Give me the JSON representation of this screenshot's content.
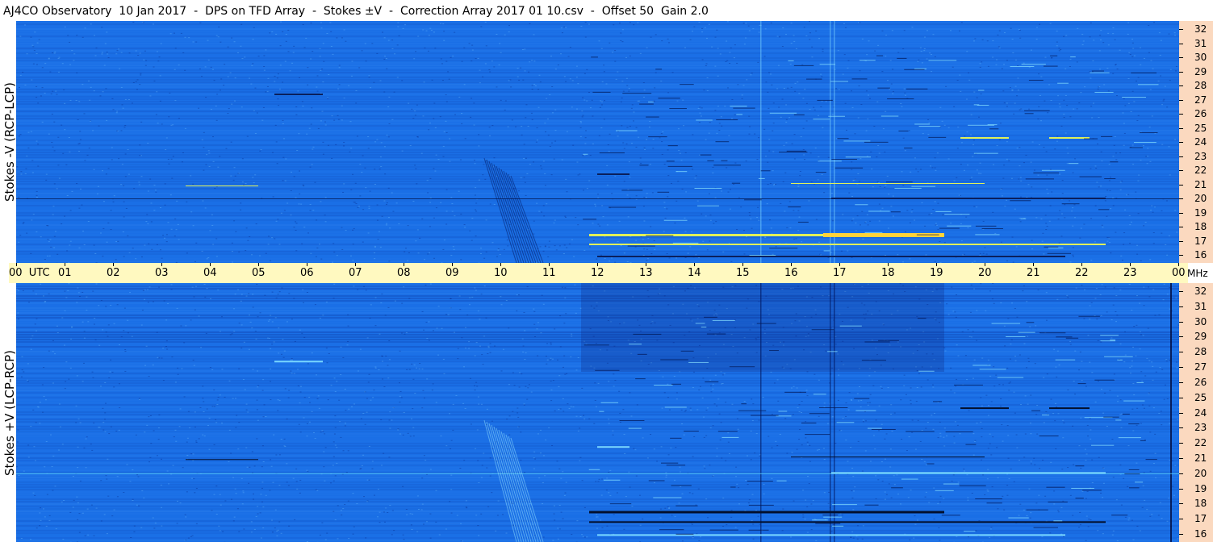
{
  "title": "AJ4CO Observatory  10 Jan 2017  -  DPS on TFD Array  -  Stokes ±V  -  Correction Array 2017 01 10.csv  -  Offset 50  Gain 2.0",
  "panels": [
    {
      "id": "top",
      "label": "Stokes -V (RCP-LCP)"
    },
    {
      "id": "bottom",
      "label": "Stokes +V (LCP-RCP)"
    }
  ],
  "time_axis": {
    "labels": [
      "00  UTC",
      "01",
      "02",
      "03",
      "04",
      "05",
      "06",
      "07",
      "08",
      "09",
      "10",
      "11",
      "12",
      "13",
      "14",
      "15",
      "16",
      "17",
      "18",
      "19",
      "20",
      "21",
      "22",
      "23",
      "00"
    ],
    "unit_label": "MHz"
  },
  "freq_axis": {
    "labels": [
      "32",
      "31",
      "30",
      "29",
      "28",
      "27",
      "26",
      "25",
      "24",
      "23",
      "22",
      "21",
      "20",
      "19",
      "18",
      "17",
      "16"
    ]
  },
  "colors": {
    "spectrogram_base": "#1a6fe6",
    "title_background": "#ffffff",
    "time_axis_background": "#fff9c0",
    "freq_axis_background": "#fbd9bf"
  }
}
